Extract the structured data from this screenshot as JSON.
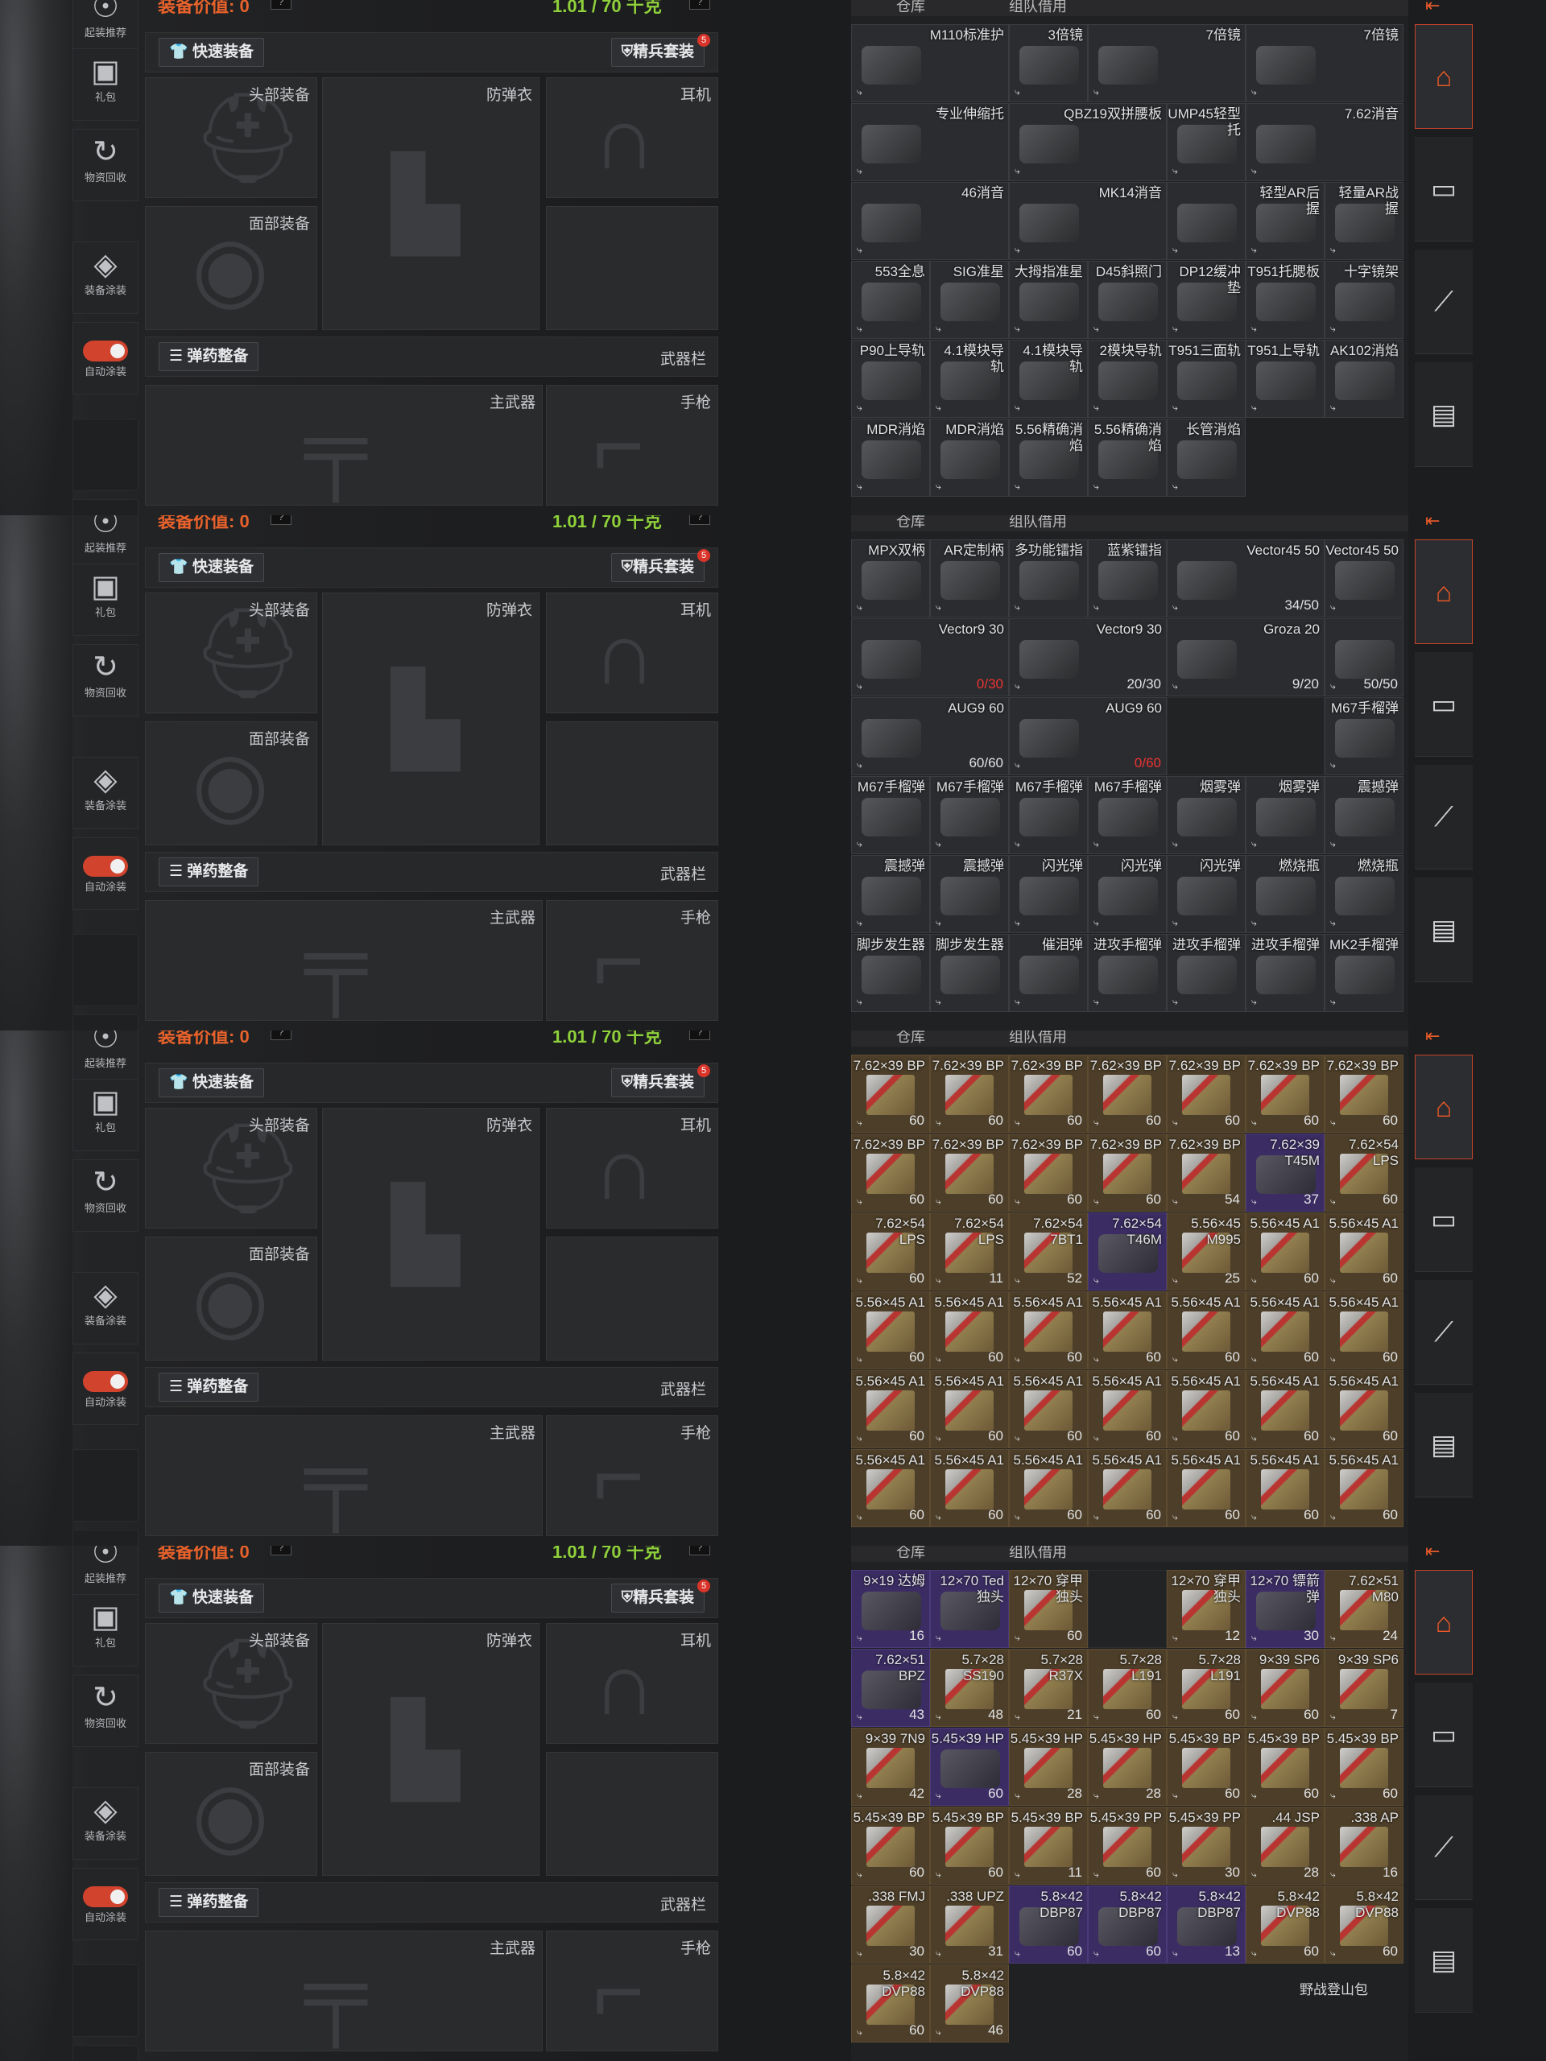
{
  "header": {
    "equip_value": "装备价值: 0",
    "capacity": "1.01 / 70 千克",
    "help_icon": "question-icon"
  },
  "sidebar": {
    "items": [
      {
        "label": "起装推荐",
        "icon": "recommend-icon"
      },
      {
        "label": "礼包",
        "icon": "gift-icon"
      },
      {
        "label": "物资回收",
        "icon": "recycle-icon"
      },
      {
        "label": "装备涂装",
        "icon": "paint-icon"
      },
      {
        "label": "自动涂装",
        "icon": "toggle-icon"
      }
    ]
  },
  "bars": {
    "quick_equip": "快速装备",
    "elite_kit": "精兵套装",
    "elite_badge": "5",
    "ammo_arrange": "弹药整备",
    "weapon_bar": "武器栏"
  },
  "slots": {
    "head": "头部装备",
    "armor": "防弹衣",
    "ear": "耳机",
    "face": "面部装备",
    "primary": "主武器",
    "pistol": "手枪"
  },
  "storage": {
    "tab_warehouse": "仓库",
    "tab_team": "组队借用",
    "footer_label": "野战登山包"
  },
  "right_nav": {
    "home": "home-icon",
    "armor": "armor-icon",
    "mag": "magazine-icon",
    "box": "storage-icon",
    "topicon": "exit-icon"
  },
  "panels": [
    {
      "cells": [
        {
          "n": "M110标准护",
          "w": 2,
          "t": ""
        },
        {
          "n": "3倍镜",
          "t": ""
        },
        {
          "n": "7倍镜",
          "w": 2,
          "t": ""
        },
        {
          "n": "7倍镜",
          "w": 2,
          "t": ""
        },
        {
          "n": "专业伸缩托",
          "w": 2,
          "t": ""
        },
        {
          "n": "QBZ19双拼腰板",
          "w": 2,
          "t": ""
        },
        {
          "n": "UMP45轻型托",
          "t": ""
        },
        {
          "n": "7.62消音",
          "w": 2,
          "t": ""
        },
        {
          "n": "46消音",
          "w": 2,
          "t": ""
        },
        {
          "n": "MK14消音",
          "w": 2,
          "t": ""
        },
        {
          "n": "",
          "t": ""
        },
        {
          "n": "轻型AR后握"
        },
        {
          "n": "轻量AR战握"
        },
        {
          "n": "553全息"
        },
        {
          "n": "SIG准星"
        },
        {
          "n": "大拇指准星"
        },
        {
          "n": "D45斜照门"
        },
        {
          "n": "DP12缓冲垫"
        },
        {
          "n": "T951托腮板"
        },
        {
          "n": "十字镜架"
        },
        {
          "n": "P90上导轨"
        },
        {
          "n": "4.1模块导轨"
        },
        {
          "n": "4.1模块导轨"
        },
        {
          "n": "2模块导轨"
        },
        {
          "n": "T951三面轨"
        },
        {
          "n": "T951上导轨"
        },
        {
          "n": "AK102消焰"
        },
        {
          "n": "MDR消焰"
        },
        {
          "n": "MDR消焰"
        },
        {
          "n": "5.56精确消焰"
        },
        {
          "n": "5.56精确消焰"
        },
        {
          "n": "长管消焰"
        }
      ]
    },
    {
      "cells": [
        {
          "n": "MPX双柄"
        },
        {
          "n": "AR定制柄"
        },
        {
          "n": "多功能镭指"
        },
        {
          "n": "蓝紫镭指"
        },
        {
          "n": "Vector45 50",
          "w": 2,
          "c": "34/50"
        },
        {
          "n": "Vector45 50",
          "c": ""
        },
        {
          "n": "Vector9 30",
          "w": 2,
          "c": "0/30",
          "red": true
        },
        {
          "n": "Vector9 30",
          "w": 2,
          "c": "20/30"
        },
        {
          "n": "Groza 20",
          "w": 2,
          "c": "9/20"
        },
        {
          "n": "",
          "c": "50/50"
        },
        {
          "n": "AUG9 60",
          "w": 2,
          "c": "60/60"
        },
        {
          "n": "AUG9 60",
          "w": 2,
          "c": "0/60",
          "red": true
        },
        {
          "n": "",
          "w": 2,
          "empty": true
        },
        {
          "n": "M67手榴弹"
        },
        {
          "n": "M67手榴弹"
        },
        {
          "n": "M67手榴弹"
        },
        {
          "n": "M67手榴弹"
        },
        {
          "n": "M67手榴弹"
        },
        {
          "n": "烟雾弹"
        },
        {
          "n": "烟雾弹"
        },
        {
          "n": "震撼弹"
        },
        {
          "n": "震撼弹"
        },
        {
          "n": "震撼弹"
        },
        {
          "n": "闪光弹"
        },
        {
          "n": "闪光弹"
        },
        {
          "n": "闪光弹"
        },
        {
          "n": "燃烧瓶"
        },
        {
          "n": "燃烧瓶"
        },
        {
          "n": "脚步发生器"
        },
        {
          "n": "脚步发生器"
        },
        {
          "n": "催泪弹"
        },
        {
          "n": "进攻手榴弹"
        },
        {
          "n": "进攻手榴弹"
        },
        {
          "n": "进攻手榴弹"
        },
        {
          "n": "MK2手榴弹"
        }
      ]
    },
    {
      "cells": [
        {
          "n": "7.62×39 BP",
          "c": "60",
          "a": 1
        },
        {
          "n": "7.62×39 BP",
          "c": "60",
          "a": 1
        },
        {
          "n": "7.62×39 BP",
          "c": "60",
          "a": 1
        },
        {
          "n": "7.62×39 BP",
          "c": "60",
          "a": 1
        },
        {
          "n": "7.62×39 BP",
          "c": "60",
          "a": 1
        },
        {
          "n": "7.62×39 BP",
          "c": "60",
          "a": 1
        },
        {
          "n": "7.62×39 BP",
          "c": "60",
          "a": 1
        },
        {
          "n": "7.62×39 BP",
          "c": "60",
          "a": 1
        },
        {
          "n": "7.62×39 BP",
          "c": "60",
          "a": 1
        },
        {
          "n": "7.62×39 BP",
          "c": "60",
          "a": 1
        },
        {
          "n": "7.62×39 BP",
          "c": "60",
          "a": 1
        },
        {
          "n": "7.62×39 BP",
          "c": "54",
          "a": 1
        },
        {
          "n": "7.62×39 T45M",
          "c": "37",
          "p": 1
        },
        {
          "n": "7.62×54 LPS",
          "c": "60",
          "a": 1
        },
        {
          "n": "7.62×54 LPS",
          "c": "60",
          "a": 1
        },
        {
          "n": "7.62×54 LPS",
          "c": "11",
          "a": 1
        },
        {
          "n": "7.62×54 7BT1",
          "c": "52",
          "a": 1
        },
        {
          "n": "7.62×54 T46M",
          "c": "",
          "p": 1
        },
        {
          "n": "5.56×45 M995",
          "c": "25",
          "a": 1
        },
        {
          "n": "5.56×45 A1",
          "c": "60",
          "a": 1
        },
        {
          "n": "5.56×45 A1",
          "c": "60",
          "a": 1
        },
        {
          "n": "5.56×45 A1",
          "c": "60",
          "a": 1
        },
        {
          "n": "5.56×45 A1",
          "c": "60",
          "a": 1
        },
        {
          "n": "5.56×45 A1",
          "c": "60",
          "a": 1
        },
        {
          "n": "5.56×45 A1",
          "c": "60",
          "a": 1
        },
        {
          "n": "5.56×45 A1",
          "c": "60",
          "a": 1
        },
        {
          "n": "5.56×45 A1",
          "c": "60",
          "a": 1
        },
        {
          "n": "5.56×45 A1",
          "c": "60",
          "a": 1
        },
        {
          "n": "5.56×45 A1",
          "c": "60",
          "a": 1
        },
        {
          "n": "5.56×45 A1",
          "c": "60",
          "a": 1
        },
        {
          "n": "5.56×45 A1",
          "c": "60",
          "a": 1
        },
        {
          "n": "5.56×45 A1",
          "c": "60",
          "a": 1
        },
        {
          "n": "5.56×45 A1",
          "c": "60",
          "a": 1
        },
        {
          "n": "5.56×45 A1",
          "c": "60",
          "a": 1
        },
        {
          "n": "5.56×45 A1",
          "c": "60",
          "a": 1
        },
        {
          "n": "5.56×45 A1",
          "c": "60",
          "a": 1
        },
        {
          "n": "5.56×45 A1",
          "c": "60",
          "a": 1
        },
        {
          "n": "5.56×45 A1",
          "c": "60",
          "a": 1
        },
        {
          "n": "5.56×45 A1",
          "c": "60",
          "a": 1
        },
        {
          "n": "5.56×45 A1",
          "c": "60",
          "a": 1
        },
        {
          "n": "5.56×45 A1",
          "c": "60",
          "a": 1
        },
        {
          "n": "5.56×45 A1",
          "c": "60",
          "a": 1
        }
      ]
    },
    {
      "cells": [
        {
          "n": "9×19 达姆",
          "c": "16",
          "p": 1
        },
        {
          "n": "12×70 Ted独头",
          "c": "",
          "p": 1
        },
        {
          "n": "12×70 穿甲独头",
          "c": "60",
          "a": 1
        },
        {
          "n": "",
          "empty": true
        },
        {
          "n": "12×70 穿甲独头",
          "c": "12",
          "a": 1
        },
        {
          "n": "12×70 镖箭弹",
          "c": "30",
          "p": 1
        },
        {
          "n": "7.62×51 M80",
          "c": "24",
          "a": 1
        },
        {
          "n": "7.62×51 BPZ",
          "c": "43",
          "p": 1
        },
        {
          "n": "5.7×28 SS190",
          "c": "48",
          "a": 1
        },
        {
          "n": "5.7×28 R37X",
          "c": "21",
          "a": 1
        },
        {
          "n": "5.7×28 L191",
          "c": "60",
          "a": 1
        },
        {
          "n": "5.7×28 L191",
          "c": "60",
          "a": 1
        },
        {
          "n": "9×39 SP6",
          "c": "60",
          "a": 1
        },
        {
          "n": "9×39 SP6",
          "c": "7",
          "a": 1
        },
        {
          "n": "9×39 7N9",
          "c": "42",
          "a": 1
        },
        {
          "n": "5.45×39 HP",
          "c": "60",
          "p": 1
        },
        {
          "n": "5.45×39 HP",
          "c": "28",
          "a": 1
        },
        {
          "n": "5.45×39 HP",
          "c": "28",
          "a": 1
        },
        {
          "n": "5.45×39 BP",
          "c": "60",
          "a": 1
        },
        {
          "n": "5.45×39 BP",
          "c": "60",
          "a": 1
        },
        {
          "n": "5.45×39 BP",
          "c": "60",
          "a": 1
        },
        {
          "n": "5.45×39 BP",
          "c": "60",
          "a": 1
        },
        {
          "n": "5.45×39 BP",
          "c": "60",
          "a": 1
        },
        {
          "n": "5.45×39 BP",
          "c": "11",
          "a": 1
        },
        {
          "n": "5.45×39 PP",
          "c": "60",
          "a": 1
        },
        {
          "n": "5.45×39 PP",
          "c": "30",
          "a": 1
        },
        {
          "n": ".44 JSP",
          "c": "28",
          "a": 1
        },
        {
          "n": ".338 AP",
          "c": "16",
          "a": 1
        },
        {
          "n": ".338 FMJ",
          "c": "30",
          "a": 1
        },
        {
          "n": ".338 UPZ",
          "c": "31",
          "a": 1
        },
        {
          "n": "5.8×42 DBP87",
          "c": "60",
          "p": 1
        },
        {
          "n": "5.8×42 DBP87",
          "c": "60",
          "p": 1
        },
        {
          "n": "5.8×42 DBP87",
          "c": "13",
          "p": 1
        },
        {
          "n": "5.8×42 DVP88",
          "c": "60",
          "a": 1
        },
        {
          "n": "5.8×42 DVP88",
          "c": "60",
          "a": 1
        },
        {
          "n": "5.8×42 DVP88",
          "c": "60",
          "a": 1
        },
        {
          "n": "5.8×42 DVP88",
          "c": "46",
          "a": 1
        }
      ]
    }
  ]
}
